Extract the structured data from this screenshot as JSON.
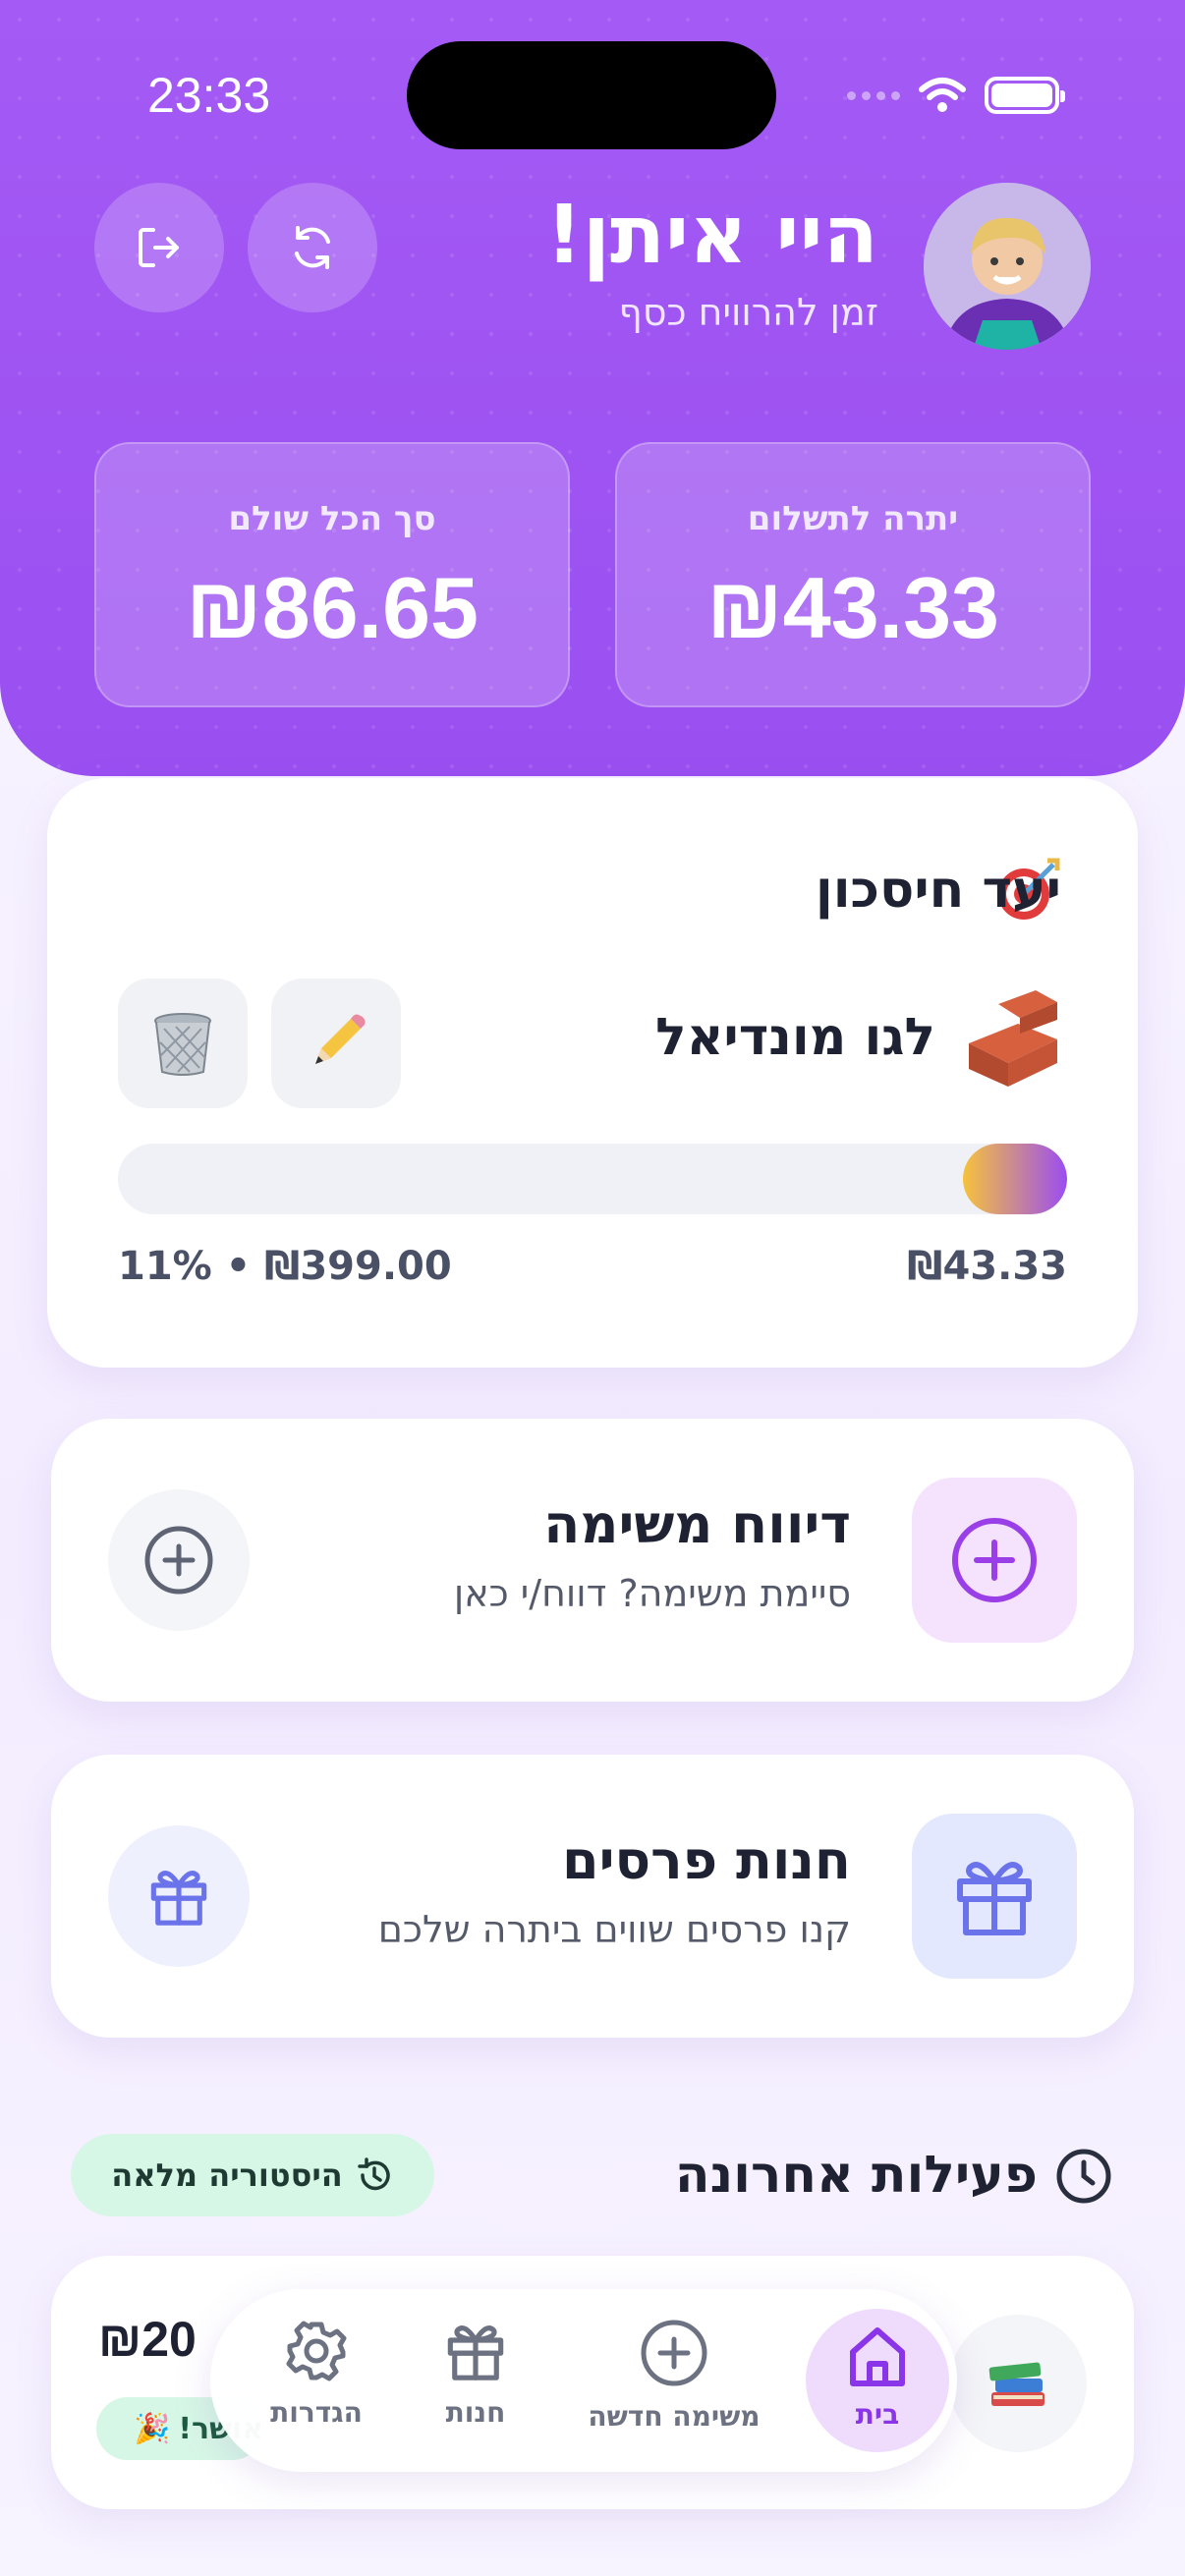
{
  "status_bar": {
    "time": "23:33"
  },
  "header": {
    "greeting": "היי איתן!",
    "subtitle": "זמן להרוויח כסף",
    "logout_icon": "logout-icon",
    "refresh_icon": "refresh-icon"
  },
  "stats": {
    "balance_label": "יתרה לתשלום",
    "balance_value": "₪43.33",
    "total_paid_label": "סך הכל שולם",
    "total_paid_value": "₪86.65"
  },
  "savings_goal": {
    "title": "יעד חיסכון",
    "name": "לגו מונדיאל",
    "current": "₪43.33",
    "target_text": "11% • ₪399.00",
    "progress_fraction": 0.11,
    "edit_icon": "pencil-icon",
    "delete_icon": "trash-icon"
  },
  "actions": {
    "report_title": "דיווח משימה",
    "report_sub": "סיימת משימה? דווח/י כאן",
    "shop_title": "חנות פרסים",
    "shop_sub": "קנו פרסים שווים ביתרה שלכם"
  },
  "recent": {
    "title": "פעילות אחרונה",
    "history_label": "היסטוריה מלאה",
    "first_item_amount": "₪20",
    "first_item_badge": "אושר!"
  },
  "nav": {
    "home": "בית",
    "new_task": "משימה חדשה",
    "shop": "חנות",
    "settings": "הגדרות"
  },
  "colors": {
    "primary": "#9d50f2",
    "accent_green": "#d7f7e6",
    "shop_bg": "#e3e8ff"
  }
}
